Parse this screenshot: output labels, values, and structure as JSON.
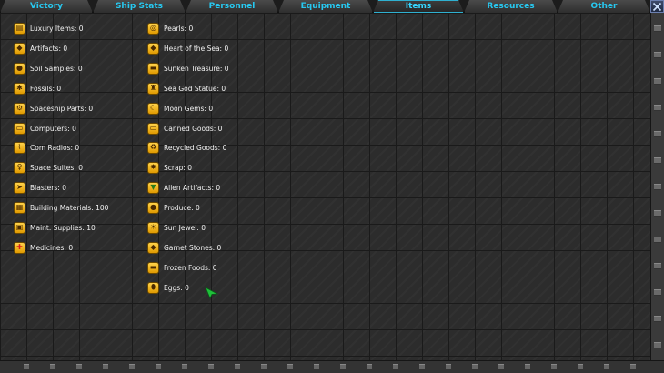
{
  "tabs": [
    {
      "label": "Victory",
      "active": false
    },
    {
      "label": "Ship Stats",
      "active": false
    },
    {
      "label": "Personnel",
      "active": false
    },
    {
      "label": "Equipment",
      "active": false
    },
    {
      "label": "Items",
      "active": true
    },
    {
      "label": "Resources",
      "active": false
    },
    {
      "label": "Other",
      "active": false
    }
  ],
  "columns": [
    {
      "items": [
        {
          "name": "luxury-items",
          "text": "Luxury Items: 0",
          "icon": "coin-stack-icon"
        },
        {
          "name": "artifacts",
          "text": "Artifacts: 0",
          "icon": "artifact-icon"
        },
        {
          "name": "soil-samples",
          "text": "Soil Samples: 0",
          "icon": "soil-icon"
        },
        {
          "name": "fossils",
          "text": "Fossils: 0",
          "icon": "fossil-icon"
        },
        {
          "name": "spaceship-parts",
          "text": "Spaceship Parts: 0",
          "icon": "ship-part-icon"
        },
        {
          "name": "computers",
          "text": "Computers: 0",
          "icon": "computer-icon"
        },
        {
          "name": "com-radios",
          "text": "Com Radios: 0",
          "icon": "radio-icon"
        },
        {
          "name": "space-suites",
          "text": "Space Suites: 0",
          "icon": "space-suit-icon"
        },
        {
          "name": "blasters",
          "text": "Blasters: 0",
          "icon": "blaster-icon"
        },
        {
          "name": "building-materials",
          "text": "Building Materials: 100",
          "icon": "building-materials-icon"
        },
        {
          "name": "maint-supplies",
          "text": "Maint. Supplies: 10",
          "icon": "supplies-icon"
        },
        {
          "name": "medicines",
          "text": "Medicines: 0",
          "icon": "medicine-icon"
        }
      ]
    },
    {
      "items": [
        {
          "name": "pearls",
          "text": "Pearls: 0",
          "icon": "pearl-icon"
        },
        {
          "name": "heart-of-the-sea",
          "text": "Heart of the Sea: 0",
          "icon": "heart-gem-icon"
        },
        {
          "name": "sunken-treasure",
          "text": "Sunken Treasure: 0",
          "icon": "treasure-icon"
        },
        {
          "name": "sea-god-statue",
          "text": "Sea God Statue: 0",
          "icon": "statue-icon"
        },
        {
          "name": "moon-gems",
          "text": "Moon Gems: 0",
          "icon": "moon-gem-icon"
        },
        {
          "name": "canned-goods",
          "text": "Canned Goods: 0",
          "icon": "can-icon"
        },
        {
          "name": "recycled-goods",
          "text": "Recycled Goods: 0",
          "icon": "recycle-icon"
        },
        {
          "name": "scrap",
          "text": "Scrap: 0",
          "icon": "scrap-icon"
        },
        {
          "name": "alien-artifacts",
          "text": "Alien Artifacts: 0",
          "icon": "alien-icon"
        },
        {
          "name": "produce",
          "text": "Produce: 0",
          "icon": "produce-icon"
        },
        {
          "name": "sun-jewel",
          "text": "Sun Jewel: 0",
          "icon": "sun-jewel-icon"
        },
        {
          "name": "garnet-stones",
          "text": "Garnet Stones: 0",
          "icon": "garnet-icon"
        },
        {
          "name": "frozen-foods",
          "text": "Frozen Foods: 0",
          "icon": "frozen-food-icon"
        },
        {
          "name": "eggs",
          "text": "Eggs: 0",
          "icon": "egg-icon"
        }
      ]
    }
  ],
  "colors": {
    "tab_text": "#27c8f0",
    "item_text": "#f2f2f2",
    "icon_fill": "#f5b21a",
    "cursor": "#1fbf3a"
  }
}
